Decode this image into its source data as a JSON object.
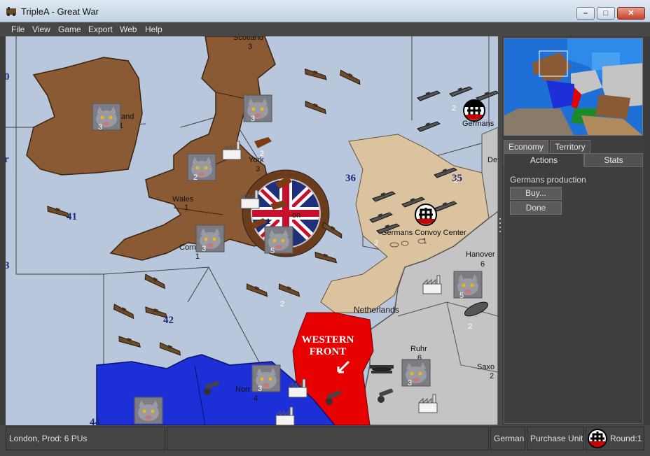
{
  "window": {
    "title": "TripleA - Great War",
    "controls": {
      "minimize": "–",
      "maximize": "□",
      "close": "✕"
    }
  },
  "menu": [
    "File",
    "View",
    "Game",
    "Export",
    "Web",
    "Help"
  ],
  "map": {
    "territories": {
      "scotland": {
        "name": "Scotland",
        "value": "3"
      },
      "ireland": {
        "name": "and",
        "value": "1"
      },
      "york": {
        "name": "York",
        "value": "3"
      },
      "wales": {
        "name": "Wales",
        "value": "1"
      },
      "london": {
        "name": "on",
        "value": "1"
      },
      "cornwall": {
        "name": "Corn",
        "value": "1"
      },
      "netherlands": {
        "name": "Netherlands"
      },
      "hanover": {
        "name": "Hanover",
        "value": "6"
      },
      "ruhr": {
        "name": "Ruhr",
        "value": "6"
      },
      "saxony": {
        "name": "Saxo",
        "value": "2"
      },
      "normandy": {
        "name": "Norr",
        "value": "4"
      },
      "denmark": {
        "name": "De"
      },
      "germans_sea": {
        "name": "Germans"
      },
      "convoy": {
        "name": "Germans Convoy Center",
        "value": "1"
      },
      "western_front": {
        "line1": "WESTERN",
        "line2": "FRONT"
      }
    },
    "sea_zones": [
      "36",
      "35",
      "41",
      "42",
      "44",
      "0",
      "r",
      "3"
    ],
    "unit_counts": {
      "ireland_inf": "3",
      "york_inf": "3",
      "york_art": "2",
      "wales_inf": "2",
      "london_inf": "5",
      "cornwall_inf": "3",
      "hanover_inf": "5",
      "ruhr_inf": "3",
      "normandy_inf": "3",
      "sz35_ships": "2",
      "convoy_ships": "2",
      "sz42_ships": "2",
      "zeppelin": "2",
      "german_fleet": "2"
    }
  },
  "side_panel": {
    "tabs_top": [
      "Economy",
      "Territory"
    ],
    "tabs_main": [
      "Actions",
      "Stats"
    ],
    "production_label": "Germans production",
    "buy_button": "Buy...",
    "done_button": "Done"
  },
  "status_bar": {
    "location": "London, Prod: 6 PUs",
    "player": "Germans",
    "step": "Purchase Units",
    "round": "Round:1"
  },
  "colors": {
    "britain": "#8a5a34",
    "germany": "#c4c4c4",
    "france": "#1d2fd6",
    "neutral": "#dcc3a0",
    "western_front": "#e60000",
    "sea": "#b9c8dc"
  }
}
